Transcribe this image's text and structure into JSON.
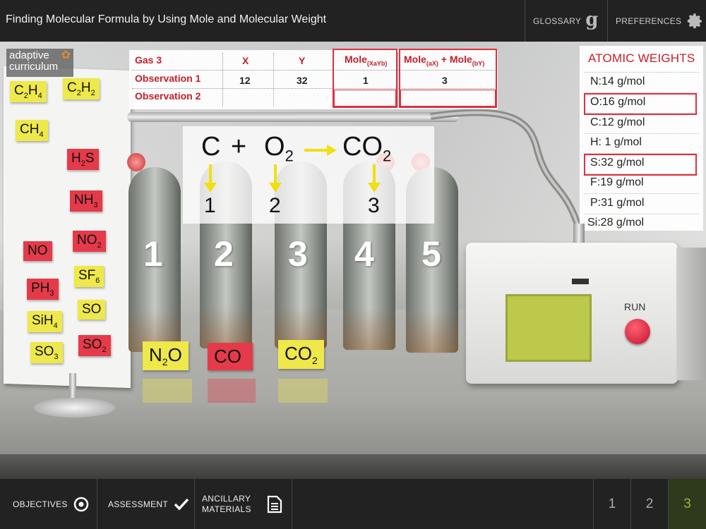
{
  "header": {
    "title": "Finding Molecular Formula by Using Mole and Molecular Weight",
    "glossary_label": "GLOSSARY",
    "glossary_icon": "g",
    "preferences_label": "PREFERENCES"
  },
  "logo": {
    "line1": "adaptive",
    "line2": "curriculum"
  },
  "board": {
    "notes": [
      {
        "base": "C",
        "sub1": "2",
        "mid": "H",
        "sub2": "4",
        "color": "yellow"
      },
      {
        "base": "C",
        "sub1": "2",
        "mid": "H",
        "sub2": "2",
        "color": "yellow"
      },
      {
        "base": "CH",
        "sub1": "4",
        "mid": "",
        "sub2": "",
        "color": "yellow"
      },
      {
        "base": "H",
        "sub1": "2",
        "mid": "S",
        "sub2": "",
        "color": "red"
      },
      {
        "base": "NH",
        "sub1": "3",
        "mid": "",
        "sub2": "",
        "color": "red"
      },
      {
        "base": "NO",
        "sub1": "",
        "mid": "",
        "sub2": "",
        "color": "red"
      },
      {
        "base": "NO",
        "sub1": "2",
        "mid": "",
        "sub2": "",
        "color": "red"
      },
      {
        "base": "SF",
        "sub1": "6",
        "mid": "",
        "sub2": "",
        "color": "yellow"
      },
      {
        "base": "PH",
        "sub1": "3",
        "mid": "",
        "sub2": "",
        "color": "red"
      },
      {
        "base": "SO",
        "sub1": "",
        "mid": "",
        "sub2": "",
        "color": "yellow"
      },
      {
        "base": "SiH",
        "sub1": "4",
        "mid": "",
        "sub2": "",
        "color": "yellow"
      },
      {
        "base": "SO",
        "sub1": "3",
        "mid": "",
        "sub2": "",
        "color": "yellow"
      },
      {
        "base": "SO",
        "sub1": "2",
        "mid": "",
        "sub2": "",
        "color": "red"
      }
    ]
  },
  "table": {
    "gas_label": "Gas 3",
    "col_x": "X",
    "col_y": "Y",
    "col_mole_base": "Mole",
    "col_mole_sub": "(XaYb)",
    "col_mole_sum_a": "Mole",
    "col_mole_sum_a_sub": "(aX)",
    "col_mole_sum_plus": " + ",
    "col_mole_sum_b": "Mole",
    "col_mole_sum_b_sub": "(bY)",
    "rows": [
      {
        "label": "Observation 1",
        "x": "12",
        "y": "32",
        "mole": "1",
        "mole_sum": "3"
      },
      {
        "label": "Observation 2",
        "x": "",
        "y": "",
        "mole": "",
        "mole_sum": ""
      }
    ]
  },
  "atomic_weights": {
    "title": "ATOMIC WEIGHTS",
    "items": [
      "N:14  g/mol",
      "O:16  g/mol",
      "C:12  g/mol",
      "H:  1  g/mol",
      "S:32  g/mol",
      "F:19  g/mol",
      "P:31  g/mol",
      "Si:28  g/mol"
    ],
    "highlighted": [
      "O:16  g/mol",
      "S:32  g/mol"
    ]
  },
  "equation": {
    "term1": "C",
    "plus": "+",
    "term2_base": "O",
    "term2_sub": "2",
    "arrow": "→",
    "term3_base": "CO",
    "term3_sub": "2",
    "coef1": "1",
    "coef2": "2",
    "coef3": "3"
  },
  "tanks": {
    "numbers": [
      "1",
      "2",
      "3",
      "4",
      "5"
    ],
    "labels": [
      {
        "base": "N",
        "sub": "2",
        "rest": "O",
        "color": "yellow"
      },
      {
        "base": "CO",
        "sub": "",
        "rest": "",
        "color": "red"
      },
      {
        "base": "CO",
        "sub": "2",
        "rest": "",
        "color": "yellow"
      }
    ]
  },
  "device": {
    "run_label": "RUN"
  },
  "footer": {
    "objectives_label": "OBJECTIVES",
    "assessment_label": "ASSESSMENT",
    "ancillary_line1": "ANCILLARY",
    "ancillary_line2": "MATERIALS",
    "pages": [
      "1",
      "2",
      "3"
    ],
    "active_page": "3"
  },
  "colors": {
    "accent_red": "#c41f2a",
    "sticky_yellow": "#eee84a",
    "sticky_red": "#e53a4a",
    "screen_green": "#bcc94a",
    "active_page_green": "#9ab23a"
  }
}
